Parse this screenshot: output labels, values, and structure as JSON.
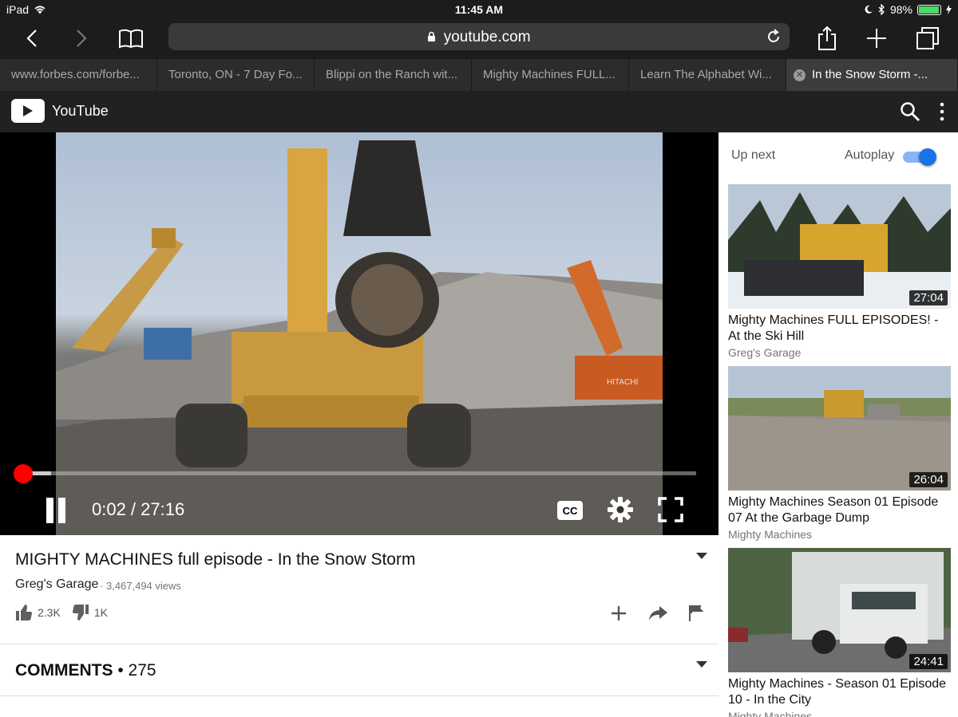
{
  "status_bar": {
    "device": "iPad",
    "time": "11:45 AM",
    "battery": "98%",
    "battery_level": 0.98
  },
  "browser": {
    "url": "youtube.com",
    "tabs": [
      {
        "title": "www.forbes.com/forbe..."
      },
      {
        "title": "Toronto, ON - 7 Day Fo..."
      },
      {
        "title": "Blippi on the Ranch wit..."
      },
      {
        "title": "Mighty Machines FULL..."
      },
      {
        "title": "Learn The Alphabet Wi..."
      },
      {
        "title": "In the Snow Storm -..."
      }
    ],
    "active_tab_index": 5
  },
  "youtube": {
    "brand": "YouTube",
    "accent_color": "#ff0000",
    "toggle_color": "#1a73e8"
  },
  "player": {
    "current_time": "0:02",
    "duration": "27:16",
    "time_display": "0:02 / 27:16",
    "played_fraction": 0.001,
    "buffered_fraction": 0.04,
    "cc_label": "CC"
  },
  "video": {
    "title": "MIGHTY MACHINES full episode - In the Snow Storm",
    "channel": "Greg's Garage",
    "views": "· 3,467,494 views",
    "likes": "2.3K",
    "dislikes": "1K"
  },
  "comments": {
    "label": "COMMENTS",
    "count": "• 275"
  },
  "sidebar": {
    "up_next_label": "Up next",
    "autoplay_label": "Autoplay",
    "autoplay_on": true,
    "videos": [
      {
        "title": "Mighty Machines FULL EPISODES! - At the Ski Hill",
        "channel": "Greg's Garage",
        "duration": "27:04"
      },
      {
        "title": "Mighty Machines Season 01 Episode 07 At the Garbage Dump",
        "channel": "Mighty Machines",
        "duration": "26:04"
      },
      {
        "title": "Mighty Machines - Season 01 Episode 10 - In the City",
        "channel": "Mighty Machines",
        "duration": "24:41"
      }
    ]
  }
}
